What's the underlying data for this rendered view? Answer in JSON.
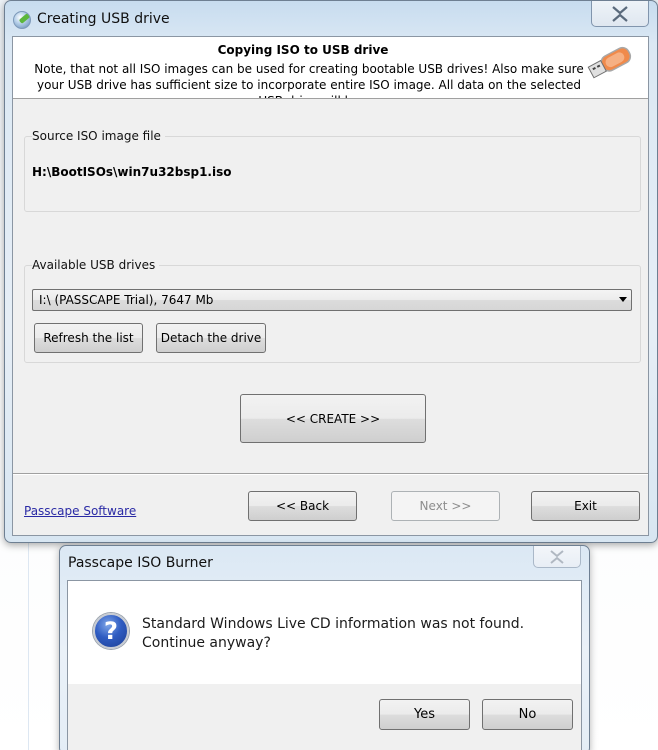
{
  "main_window": {
    "title": "Creating USB drive",
    "app_icon": "app-globe-icon",
    "close_icon": "close-icon",
    "header": {
      "title": "Copying ISO to USB drive",
      "note": "Note, that not all ISO images can be used for creating bootable USB drives! Also make sure your USB drive has sufficient size to incorporate entire ISO image. All data on the selected USB drive will be",
      "icon": "usb-drive-icon"
    },
    "source_group": {
      "label": "Source ISO image file",
      "path": "H:\\BootISOs\\win7u32bsp1.iso"
    },
    "usb_group": {
      "label": "Available USB drives",
      "selected_drive": "I:\\ (PASSCAPE Trial),  7647 Mb",
      "refresh_label": "Refresh the list",
      "detach_label": "Detach the drive"
    },
    "create_label": "<< CREATE >>",
    "footer": {
      "link_label": "Passcape Software",
      "back_label": "<< Back",
      "next_label": "Next >>",
      "exit_label": "Exit"
    }
  },
  "message_box": {
    "title": "Passcape ISO Burner",
    "icon": "question-icon",
    "message": "Standard Windows Live CD information was not found. Continue anyway?",
    "yes_label": "Yes",
    "no_label": "No"
  }
}
